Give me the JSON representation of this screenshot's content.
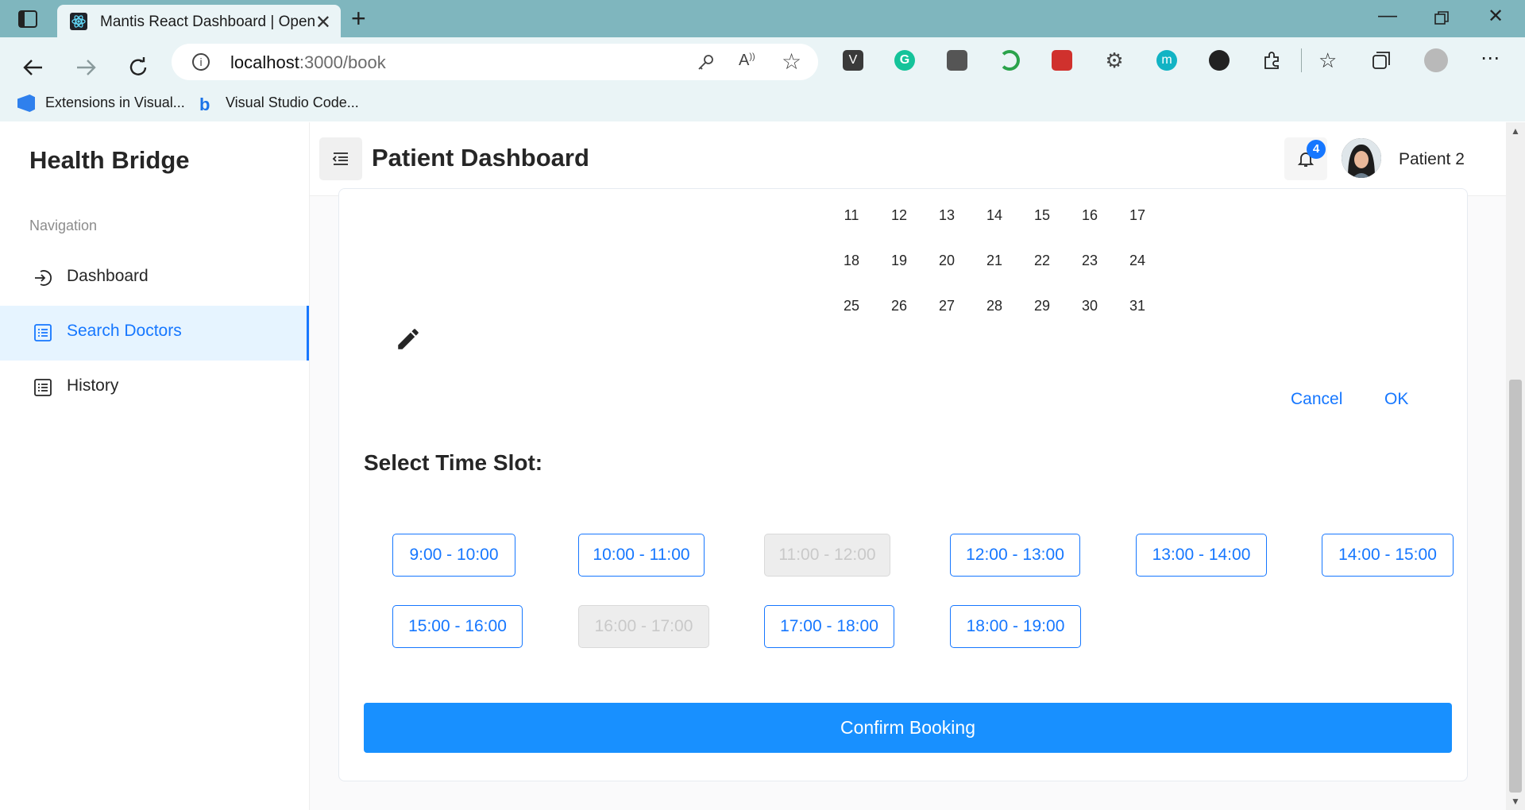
{
  "browser": {
    "tab_title": "Mantis React Dashboard | Open",
    "url_host": "localhost",
    "url_path": ":3000/book",
    "bookmarks": [
      "Extensions in Visual...",
      "Visual Studio Code..."
    ]
  },
  "sidebar": {
    "brand": "Health Bridge",
    "caption": "Navigation",
    "items": [
      {
        "label": "Dashboard",
        "icon": "login-icon",
        "active": false
      },
      {
        "label": "Search Doctors",
        "icon": "list-icon",
        "active": true
      },
      {
        "label": "History",
        "icon": "list-icon",
        "active": false
      }
    ]
  },
  "header": {
    "title": "Patient Dashboard",
    "notification_count": "4",
    "user_name": "Patient 2"
  },
  "calendar": {
    "rows": [
      [
        "11",
        "12",
        "13",
        "14",
        "15",
        "16",
        "17"
      ],
      [
        "18",
        "19",
        "20",
        "21",
        "22",
        "23",
        "24"
      ],
      [
        "25",
        "26",
        "27",
        "28",
        "29",
        "30",
        "31"
      ]
    ],
    "cancel_label": "Cancel",
    "ok_label": "OK"
  },
  "timeslots": {
    "title": "Select Time Slot:",
    "slots": [
      {
        "label": "9:00 - 10:00",
        "disabled": false
      },
      {
        "label": "10:00 - 11:00",
        "disabled": false
      },
      {
        "label": "11:00 - 12:00",
        "disabled": true
      },
      {
        "label": "12:00 - 13:00",
        "disabled": false
      },
      {
        "label": "13:00 - 14:00",
        "disabled": false
      },
      {
        "label": "14:00 - 15:00",
        "disabled": false
      },
      {
        "label": "15:00 - 16:00",
        "disabled": false
      },
      {
        "label": "16:00 - 17:00",
        "disabled": true
      },
      {
        "label": "17:00 - 18:00",
        "disabled": false
      },
      {
        "label": "18:00 - 19:00",
        "disabled": false
      }
    ],
    "confirm_label": "Confirm Booking"
  },
  "colors": {
    "primary": "#1677ff",
    "confirm_bg": "#1890ff",
    "tabbar": "#7fb6be",
    "toolbar": "#eaf4f6"
  }
}
